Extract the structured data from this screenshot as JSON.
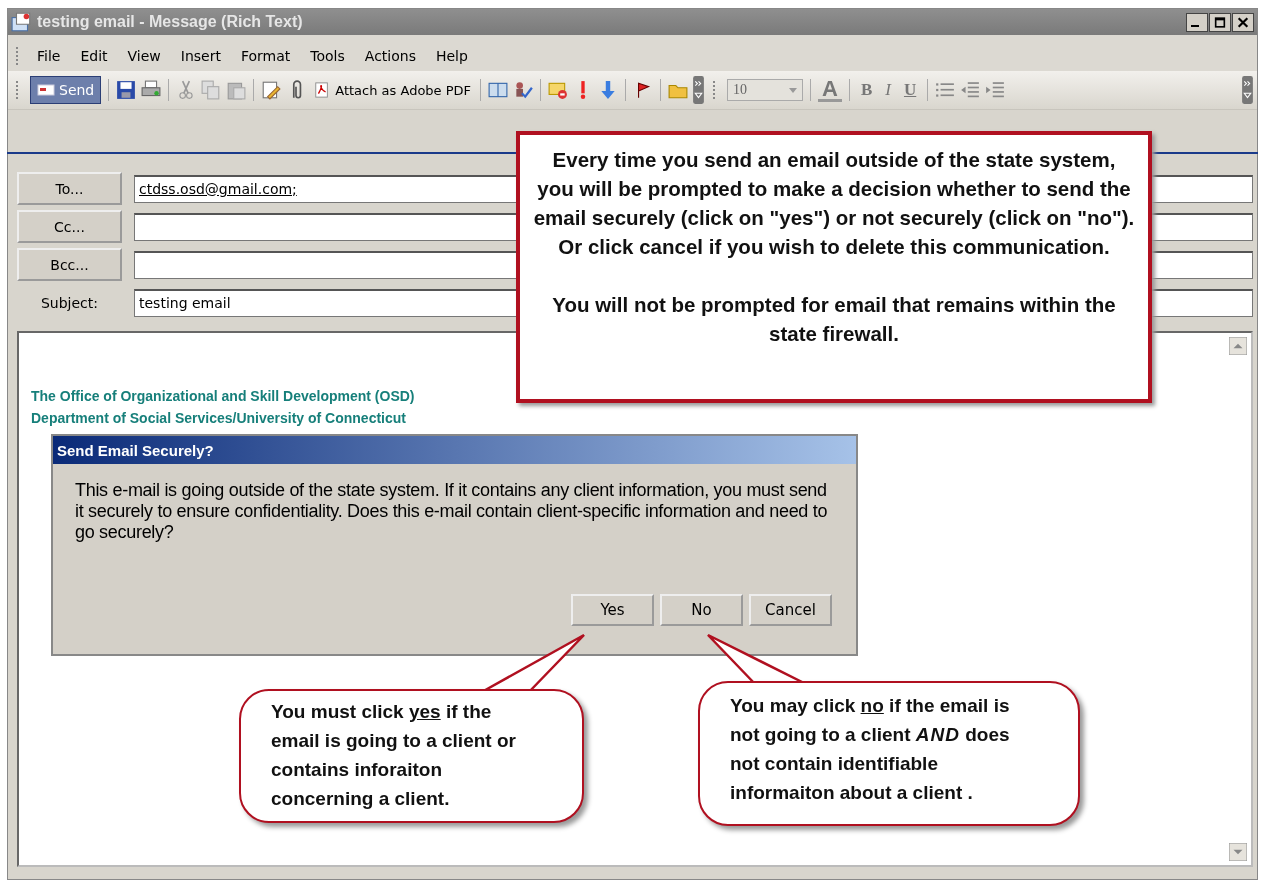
{
  "window": {
    "title": "testing email - Message (Rich Text)"
  },
  "menu": [
    "File",
    "Edit",
    "View",
    "Insert",
    "Format",
    "Tools",
    "Actions",
    "Help"
  ],
  "toolbar": {
    "send": "Send",
    "attach_pdf": "Attach as Adobe PDF",
    "font_size": "10",
    "format_letters": [
      "A",
      "B",
      "I",
      "U"
    ]
  },
  "address_fields": [
    {
      "kind": "button",
      "label": "To...",
      "value": "ctdss.osd@gmail.com;"
    },
    {
      "kind": "button",
      "label": "Cc..."
    },
    {
      "kind": "button",
      "label": "Bcc..."
    },
    {
      "kind": "label",
      "label": "Subject:",
      "value": "testing email"
    }
  ],
  "body": {
    "signature": [
      "The Office of Organizational and Skill Development (OSD)",
      "Department of Social Services/University of Connecticut"
    ]
  },
  "dialog": {
    "title": "Send Email Securely?",
    "message": "This e-mail is going outside of the state system. If it contains any client information, you must send it securely to ensure confidentiality. Does this e-mail contain client-specific information and need to go securely?",
    "buttons": [
      "Yes",
      "No",
      "Cancel"
    ]
  },
  "note": {
    "paragraphs": [
      "Every time you send an email outside of the state system, you will be prompted to make a decision whether to send the email securely (click on \"yes\") or not securely (click on \"no\").  Or click cancel if you wish to delete this communication.",
      "You will not be prompted for email that remains within the state firewall."
    ]
  },
  "bubbles": [
    {
      "segments": [
        {
          "text": "You must click ",
          "kind": "plain"
        },
        {
          "text": "yes",
          "kind": "underline"
        },
        {
          "text": " if the email is going to a client or contains inforaiton concerning a client.",
          "kind": "plain"
        }
      ]
    },
    {
      "segments": [
        {
          "text": "You may click ",
          "kind": "plain"
        },
        {
          "text": "no",
          "kind": "underline"
        },
        {
          "text": " if the email is not going to a client ",
          "kind": "plain"
        },
        {
          "text": "AND",
          "kind": "italic"
        },
        {
          "text": " does not contain identifiable informaiton about a client .",
          "kind": "plain"
        }
      ]
    }
  ]
}
